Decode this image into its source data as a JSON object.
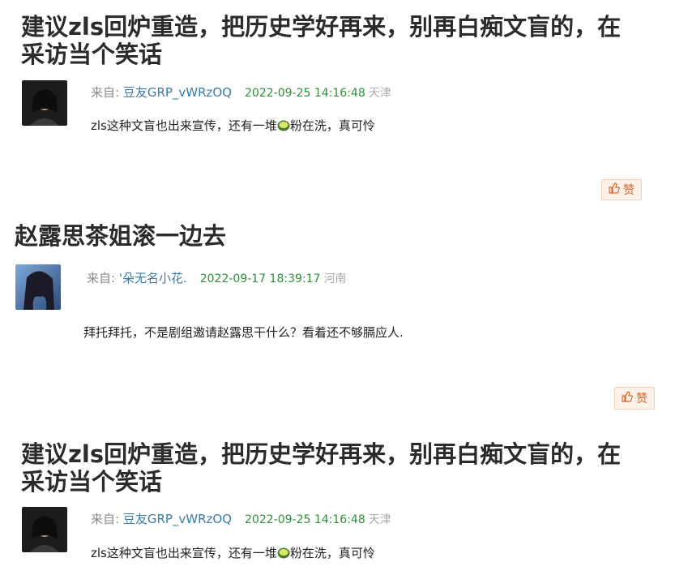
{
  "posts": [
    {
      "title_line1": "建议zls回炉重造，把历史学好再来，别再白痴文盲的，在",
      "title_line2": "采访当个笑话",
      "from_label": "来自: ",
      "author": "豆友GRP_vWRzOQ",
      "time": "2022-09-25 14:16:48",
      "location": "天津",
      "content_before": "zls这种文盲也出来宣传，还有一堆",
      "emoji": "melon-emoji",
      "content_after": "粉在洗，真可怜",
      "like_label": "赞"
    },
    {
      "title_line1": "赵露思茶姐滚一边去",
      "from_label": "来自: ",
      "author": "'朵无名小花.",
      "time": "2022-09-17 18:39:17",
      "location": "河南",
      "content": "拜托拜托，不是剧组邀请赵露思干什么？看着还不够膈应人.",
      "like_label": "赞"
    },
    {
      "title_line1": "建议zls回炉重造，把历史学好再来，别再白痴文盲的，在",
      "title_line2": "采访当个笑话",
      "from_label": "来自: ",
      "author": "豆友GRP_vWRzOQ",
      "time": "2022-09-25 14:16:48",
      "location": "天津",
      "content_before": "zls这种文盲也出来宣传，还有一堆",
      "emoji": "melon-emoji",
      "content_after": "粉在洗，真可怜"
    }
  ],
  "colors": {
    "author": "#3a7aa8",
    "time": "#2f8f3a",
    "location": "#aaaaaa",
    "like": "#d6652b"
  }
}
